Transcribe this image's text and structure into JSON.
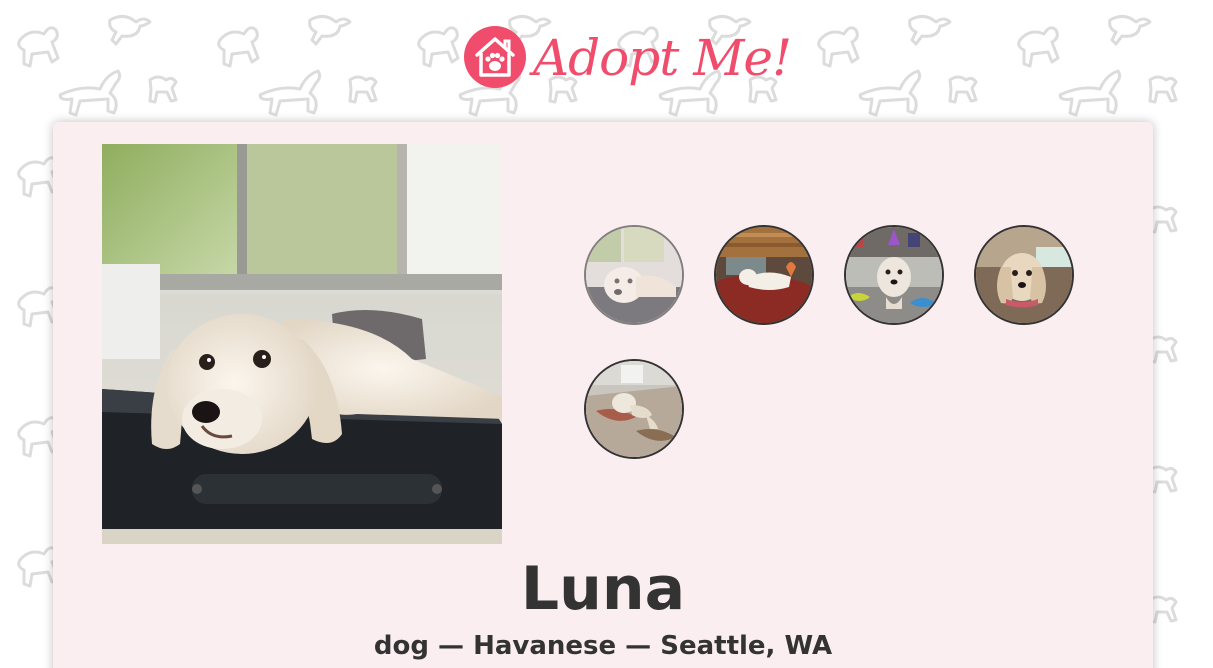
{
  "header": {
    "logo_text": "Adopt Me!",
    "logo_icon": "house-paw-icon"
  },
  "colors": {
    "brand": "#f04d6d",
    "card_background": "#faeef0",
    "text": "#333333"
  },
  "pet": {
    "name": "Luna",
    "animal": "dog",
    "breed": "Havanese",
    "location": "Seattle, WA",
    "subtitle": "dog — Havanese — Seattle, WA",
    "active_image_index": 0,
    "image_count": 5
  }
}
